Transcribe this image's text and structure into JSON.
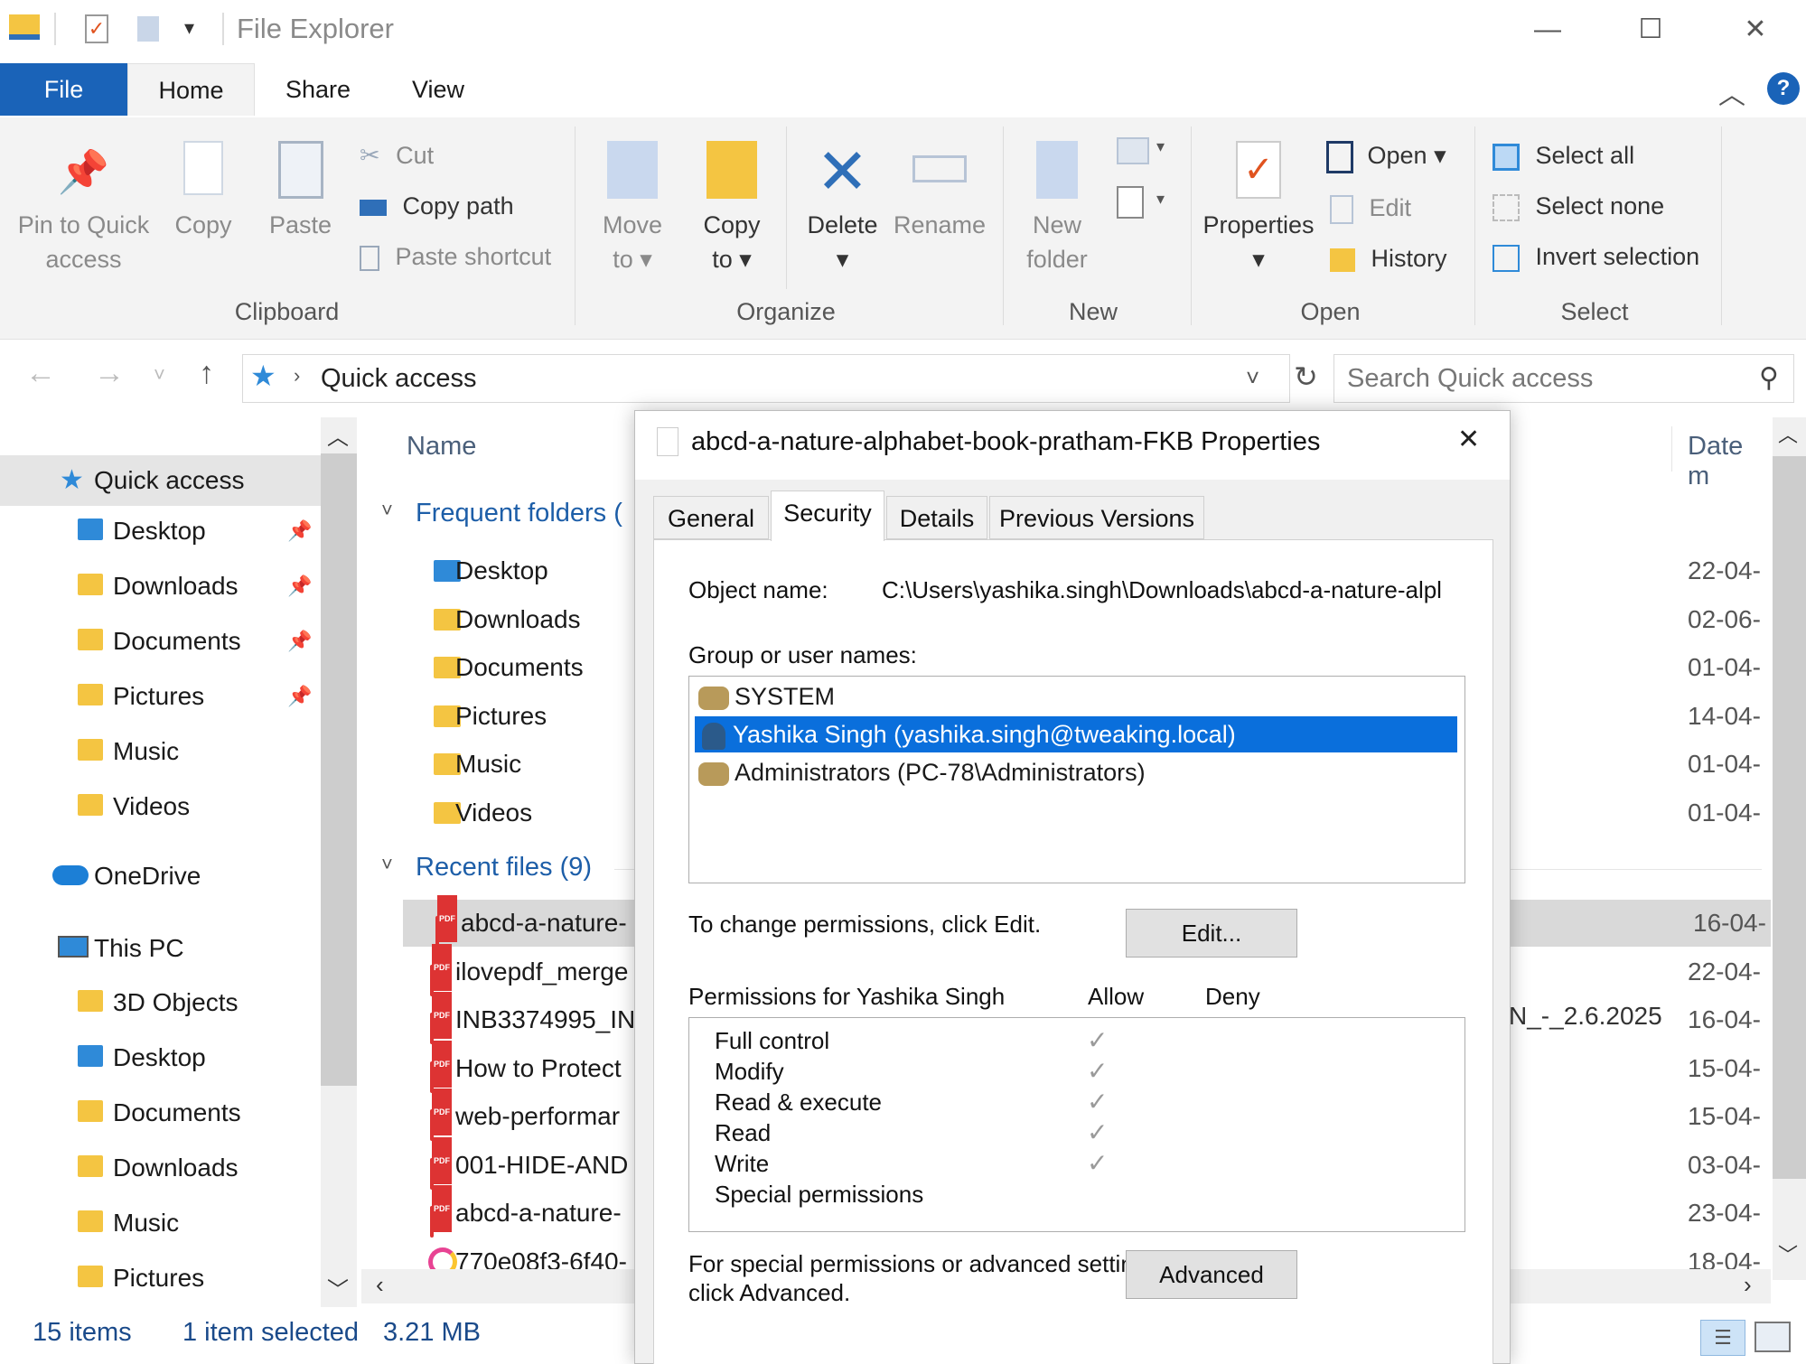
{
  "window": {
    "title": "File Explorer",
    "minimize": "—",
    "maximize": "☐",
    "close": "✕"
  },
  "ribbon_tabs": [
    "File",
    "Home",
    "Share",
    "View"
  ],
  "ribbon": {
    "clipboard": {
      "pin_to_quick_access": [
        "Pin to Quick",
        "access"
      ],
      "copy": "Copy",
      "paste": "Paste",
      "cut": "Cut",
      "copy_path": "Copy path",
      "paste_shortcut": "Paste shortcut",
      "label": "Clipboard"
    },
    "organize": {
      "move_to": [
        "Move",
        "to ▾"
      ],
      "copy_to": [
        "Copy",
        "to ▾"
      ],
      "delete": [
        "Delete",
        "▾"
      ],
      "rename": "Rename",
      "label": "Organize"
    },
    "new": {
      "new_folder": [
        "New",
        "folder"
      ],
      "label": "New"
    },
    "open": {
      "properties": [
        "Properties",
        "▾"
      ],
      "open": "Open ▾",
      "edit": "Edit",
      "history": "History",
      "label": "Open"
    },
    "select": {
      "select_all": "Select all",
      "select_none": "Select none",
      "invert_selection": "Invert selection",
      "label": "Select"
    }
  },
  "address": {
    "path": "Quick access",
    "search_placeholder": "Search Quick access"
  },
  "nav": {
    "quick_access": "Quick access",
    "quick_items": [
      "Desktop",
      "Downloads",
      "Documents",
      "Pictures",
      "Music",
      "Videos"
    ],
    "onedrive": "OneDrive",
    "this_pc": "This PC",
    "pc_items": [
      "3D Objects",
      "Desktop",
      "Documents",
      "Downloads",
      "Music",
      "Pictures"
    ]
  },
  "main": {
    "col_name": "Name",
    "col_date": "Date m",
    "frequent_header": "Frequent folders (",
    "frequent": [
      "Desktop",
      "Downloads",
      "Documents",
      "Pictures",
      "Music",
      "Videos"
    ],
    "frequent_dates": [
      "22-04-",
      "02-06-",
      "01-04-",
      "14-04-",
      "01-04-",
      "01-04-"
    ],
    "recent_header": "Recent files (9)",
    "recent": [
      "abcd-a-nature-",
      "ilovepdf_merge",
      "INB3374995_IN",
      "How to Protect",
      "web-performar",
      "001-HIDE-AND",
      "abcd-a-nature-",
      "770e08f3-6f40-"
    ],
    "recent_dates": [
      "16-04-",
      "22-04-",
      "16-04-",
      "15-04-",
      "15-04-",
      "03-04-",
      "23-04-",
      "18-04-"
    ],
    "partial_text": "N_-_2.6.2025"
  },
  "status": {
    "count": "15 items",
    "selected": "1 item selected",
    "size": "3.21 MB"
  },
  "dialog": {
    "title": "abcd-a-nature-alphabet-book-pratham-FKB Properties",
    "close": "✕",
    "tabs": [
      "General",
      "Security",
      "Details",
      "Previous Versions"
    ],
    "object_label": "Object name:",
    "object_value": "C:\\Users\\yashika.singh\\Downloads\\abcd-a-nature-alpl",
    "group_label": "Group or user names:",
    "users": [
      "SYSTEM",
      "Yashika Singh (yashika.singh@tweaking.local)",
      "Administrators (PC-78\\Administrators)"
    ],
    "change_text": "To change permissions, click Edit.",
    "edit_button": "Edit...",
    "perm_label": "Permissions for Yashika Singh",
    "allow": "Allow",
    "deny": "Deny",
    "permissions": [
      {
        "name": "Full control",
        "allow": "✓"
      },
      {
        "name": "Modify",
        "allow": "✓"
      },
      {
        "name": "Read & execute",
        "allow": "✓"
      },
      {
        "name": "Read",
        "allow": "✓"
      },
      {
        "name": "Write",
        "allow": "✓"
      },
      {
        "name": "Special permissions",
        "allow": ""
      }
    ],
    "advanced_text_1": "For special permissions or advanced settings,",
    "advanced_text_2": "click Advanced.",
    "advanced_button": "Advanced"
  }
}
